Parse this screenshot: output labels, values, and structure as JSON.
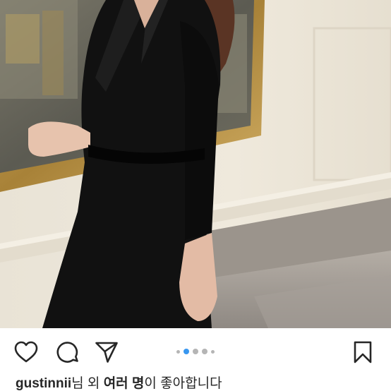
{
  "post": {
    "photo_alt": "woman in black blazer dress walking in gallery hallway",
    "carousel": {
      "count": 5,
      "active": 1
    },
    "actions": {
      "like_icon": "heart-icon",
      "comment_icon": "comment-icon",
      "share_icon": "paper-plane-icon",
      "save_icon": "bookmark-icon"
    },
    "likes": {
      "username": "gustinnii",
      "suffix_1": "님 외 ",
      "others": "여러 명",
      "suffix_2": "이 좋아합니다"
    }
  },
  "colors": {
    "icon": "#262626",
    "dot_active": "#3897f0",
    "dot_inactive": "#b5b5b5"
  }
}
